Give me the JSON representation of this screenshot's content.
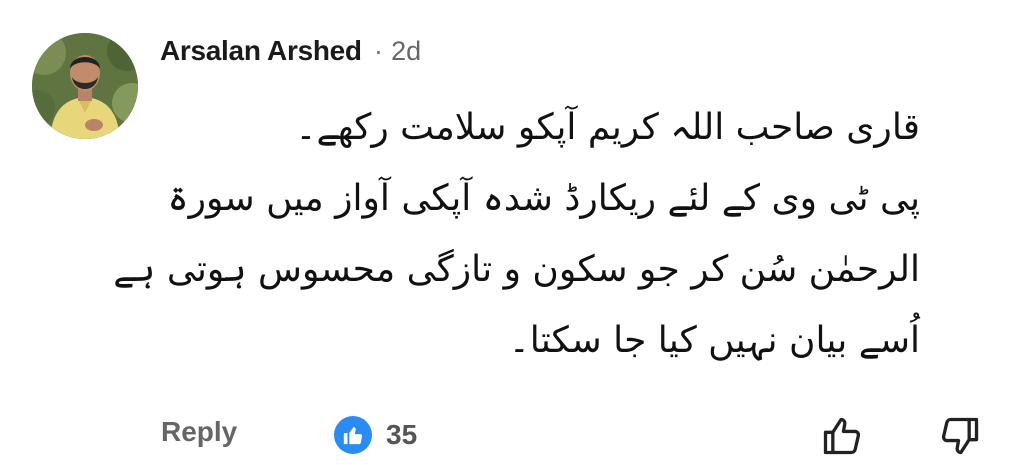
{
  "comment": {
    "author": "Arsalan Arshed",
    "separator": "·",
    "time_ago": "2d",
    "text_lines": [
      "قاری صاحب اللہ کریم آپکو سلامت رکھے۔",
      "پی ٹی وی کے لئے ریکارڈ شدہ آپکی آواز میں سورۃ",
      "الرحمٰن سُن کر جو سکون و تازگی محسوس ہوتی ہے",
      "اُسے بیان نہیں کیا جا سکتا۔"
    ]
  },
  "actions": {
    "reply_label": "Reply",
    "like_count": "35",
    "like_icon": "thumbs-up-filled-icon",
    "upvote_icon": "thumb-up-outline-icon",
    "downvote_icon": "thumb-down-outline-icon"
  },
  "colors": {
    "like_badge": "#2a8bf2",
    "author": "#1a1a1a",
    "muted": "#666666"
  }
}
